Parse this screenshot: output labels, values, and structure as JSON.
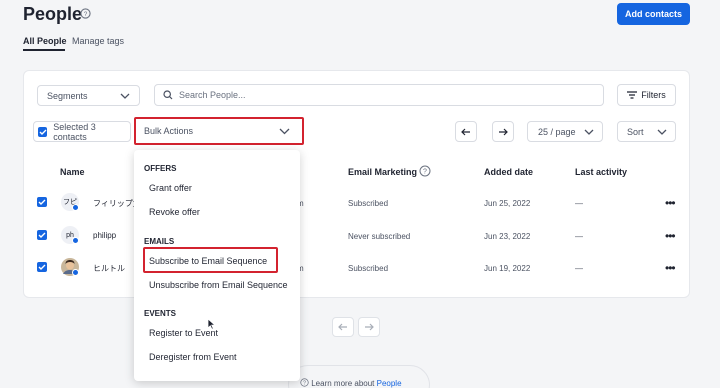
{
  "header": {
    "title": "People",
    "add_button": "Add contacts"
  },
  "tabs": [
    {
      "label": "All People",
      "active": true
    },
    {
      "label": "Manage tags",
      "active": false
    }
  ],
  "toolbar": {
    "segments_label": "Segments",
    "search_placeholder": "Search People...",
    "filters_label": "Filters",
    "selected_label": "Selected 3 contacts",
    "bulk_actions_label": "Bulk Actions",
    "per_page_label": "25 / page",
    "sort_label": "Sort"
  },
  "table": {
    "columns": [
      "Name",
      "Email Marketing",
      "Added date",
      "Last activity"
    ],
    "rows": [
      {
        "avatar": "フピ",
        "name": "フィリップ太",
        "email_tail": "m",
        "email_marketing": "Subscribed",
        "added": "Jun 25, 2022",
        "last": "—"
      },
      {
        "avatar": "ph",
        "name": "philipp",
        "email_tail": "",
        "email_marketing": "Never subscribed",
        "added": "Jun 23, 2022",
        "last": "—"
      },
      {
        "avatar": "",
        "name": "ヒルトル",
        "email_tail": "m",
        "email_marketing": "Subscribed",
        "added": "Jun 19, 2022",
        "last": "—"
      }
    ]
  },
  "bulk_menu": {
    "sections": [
      {
        "heading": "OFFERS",
        "items": [
          "Grant offer",
          "Revoke offer"
        ]
      },
      {
        "heading": "EMAILS",
        "items": [
          "Subscribe to Email Sequence",
          "Unsubscribe from Email Sequence"
        ]
      },
      {
        "heading": "EVENTS",
        "items": [
          "Register to Event",
          "Deregister from Event"
        ]
      }
    ]
  },
  "footer": {
    "learn_prefix": "Learn more about",
    "learn_link": "People"
  },
  "colors": {
    "accent": "#1565e0",
    "highlight_box": "#d3232f"
  }
}
